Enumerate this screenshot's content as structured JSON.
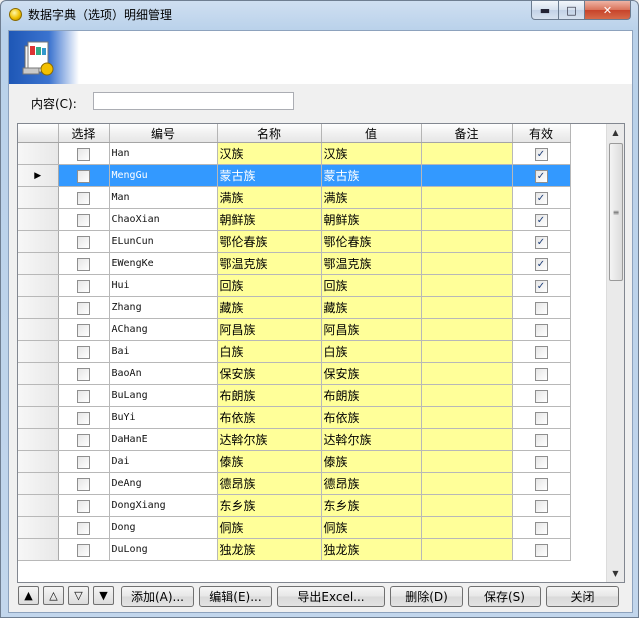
{
  "window": {
    "title": "数据字典（选项）明细管理",
    "min_glyph": "▬",
    "max_glyph": "□",
    "close_glyph": "✕"
  },
  "form": {
    "content_label": "内容(C):",
    "content_value": ""
  },
  "grid": {
    "columns": [
      "选择",
      "编号",
      "名称",
      "值",
      "备注",
      "有效"
    ],
    "selected_row_marker": "▶",
    "rows": [
      {
        "code": "Han",
        "name": "汉族",
        "value": "汉族",
        "note": "",
        "checked": false,
        "valid": true
      },
      {
        "code": "MengGu",
        "name": "蒙古族",
        "value": "蒙古族",
        "note": "",
        "checked": false,
        "valid": true
      },
      {
        "code": "Man",
        "name": "满族",
        "value": "满族",
        "note": "",
        "checked": false,
        "valid": true
      },
      {
        "code": "ChaoXian",
        "name": "朝鲜族",
        "value": "朝鲜族",
        "note": "",
        "checked": false,
        "valid": true
      },
      {
        "code": "ELunCun",
        "name": "鄂伦春族",
        "value": "鄂伦春族",
        "note": "",
        "checked": false,
        "valid": true
      },
      {
        "code": "EWengKe",
        "name": "鄂温克族",
        "value": "鄂温克族",
        "note": "",
        "checked": false,
        "valid": true
      },
      {
        "code": "Hui",
        "name": "回族",
        "value": "回族",
        "note": "",
        "checked": false,
        "valid": true
      },
      {
        "code": "Zhang",
        "name": "藏族",
        "value": "藏族",
        "note": "",
        "checked": false,
        "valid": false
      },
      {
        "code": "AChang",
        "name": "阿昌族",
        "value": "阿昌族",
        "note": "",
        "checked": false,
        "valid": false
      },
      {
        "code": "Bai",
        "name": "白族",
        "value": "白族",
        "note": "",
        "checked": false,
        "valid": false
      },
      {
        "code": "BaoAn",
        "name": "保安族",
        "value": "保安族",
        "note": "",
        "checked": false,
        "valid": false
      },
      {
        "code": "BuLang",
        "name": "布朗族",
        "value": "布朗族",
        "note": "",
        "checked": false,
        "valid": false
      },
      {
        "code": "BuYi",
        "name": "布依族",
        "value": "布依族",
        "note": "",
        "checked": false,
        "valid": false
      },
      {
        "code": "DaHanE",
        "name": "达斡尔族",
        "value": "达斡尔族",
        "note": "",
        "checked": false,
        "valid": false
      },
      {
        "code": "Dai",
        "name": "傣族",
        "value": "傣族",
        "note": "",
        "checked": false,
        "valid": false
      },
      {
        "code": "DeAng",
        "name": "德昂族",
        "value": "德昂族",
        "note": "",
        "checked": false,
        "valid": false
      },
      {
        "code": "DongXiang",
        "name": "东乡族",
        "value": "东乡族",
        "note": "",
        "checked": false,
        "valid": false
      },
      {
        "code": "Dong",
        "name": "侗族",
        "value": "侗族",
        "note": "",
        "checked": false,
        "valid": false
      },
      {
        "code": "DuLong",
        "name": "独龙族",
        "value": "独龙族",
        "note": "",
        "checked": false,
        "valid": false
      }
    ],
    "selected_index": 1,
    "check_glyph": "✓"
  },
  "nav": {
    "first": "▲",
    "prev": "△",
    "next": "▽",
    "last": "▼"
  },
  "buttons": {
    "add": "添加(A)...",
    "edit": "编辑(E)...",
    "export": "导出Excel...",
    "delete": "删除(D)",
    "save": "保存(S)",
    "close": "关闭"
  },
  "scrollbar": {
    "up": "▲",
    "down": "▼",
    "grip": "≡"
  }
}
